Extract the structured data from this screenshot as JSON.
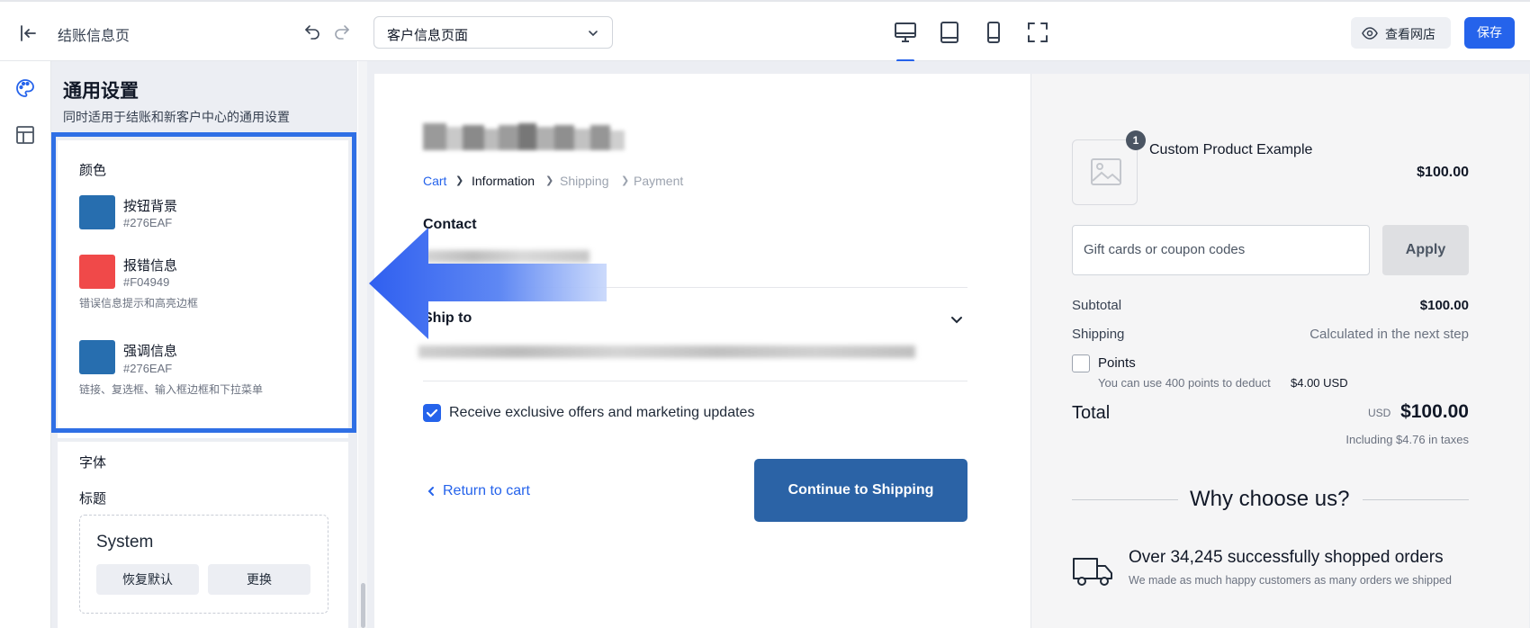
{
  "topbar": {
    "page_name": "结账信息页",
    "page_select": "客户信息页面",
    "view_store": "查看网店",
    "save": "保存"
  },
  "panel": {
    "title": "通用设置",
    "subtitle": "同时适用于结账和新客户中心的通用设置",
    "colors_label": "颜色",
    "colors": [
      {
        "name": "按钮背景",
        "hex": "#276EAF",
        "desc": ""
      },
      {
        "name": "报错信息",
        "hex": "#F04949",
        "desc": "错误信息提示和高亮边框"
      },
      {
        "name": "强调信息",
        "hex": "#276EAF",
        "desc": "链接、复选框、输入框边框和下拉菜单"
      }
    ],
    "font_label": "字体",
    "heading_label": "标题",
    "font_name": "System",
    "reset": "恢复默认",
    "change": "更换"
  },
  "checkout": {
    "breadcrumbs": [
      "Cart",
      "Information",
      "Shipping",
      "Payment"
    ],
    "contact": "Contact",
    "ship_to": "Ship to",
    "marketing": "Receive exclusive offers and marketing updates",
    "return": "Return to cart",
    "continue": "Continue to Shipping"
  },
  "summary": {
    "qty": "1",
    "product": "Custom Product Example",
    "price": "$100.00",
    "coupon_placeholder": "Gift cards or coupon codes",
    "apply": "Apply",
    "subtotal_label": "Subtotal",
    "subtotal": "$100.00",
    "shipping_label": "Shipping",
    "shipping": "Calculated in the next step",
    "points_label": "Points",
    "points_note": "You can use 400 points to deduct",
    "points_amount": "$4.00 USD",
    "total_label": "Total",
    "currency": "USD",
    "total": "$100.00",
    "tax_note": "Including $4.76 in taxes",
    "why_title": "Why choose us?",
    "orders_title": "Over 34,245 successfully shopped orders",
    "orders_desc": "We made as much happy customers as many orders we shipped"
  },
  "icons": [
    "exit-icon",
    "undo-icon",
    "redo-icon",
    "desktop-icon",
    "tablet-icon",
    "mobile-icon",
    "fullscreen-icon",
    "eye-icon",
    "palette-icon",
    "layout-icon",
    "chevron-down-icon",
    "image-placeholder-icon",
    "truck-icon",
    "check-icon",
    "chevron-left-icon"
  ],
  "colors": {
    "primary": "#2563eb",
    "button_bg": "#276EAF",
    "error": "#F04949"
  }
}
